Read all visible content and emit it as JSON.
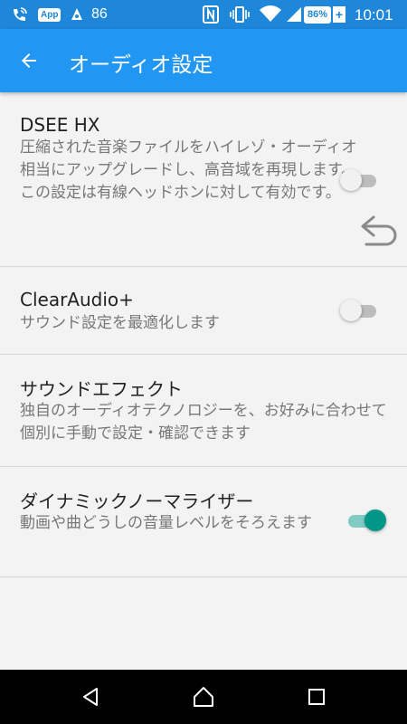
{
  "status_bar": {
    "notification_count": "86",
    "battery_percent": "86%",
    "time": "10:01",
    "icons": [
      "wifi-call-icon",
      "app-icon",
      "notification-icon",
      "nfc-icon",
      "vibrate-icon",
      "wifi-icon",
      "signal-icon",
      "battery-icon",
      "charging-icon"
    ],
    "app_badge": "App"
  },
  "app_bar": {
    "back_icon": "arrow-back-icon",
    "title": "オーディオ設定",
    "color": "#2196f3"
  },
  "settings": {
    "dsee": {
      "title": "DSEE HX",
      "description": "圧縮された音楽ファイルをハイレゾ・オーディオ相当にアップグレードし、高音域を再現します。この設定は有線ヘッドホンに対して有効です。",
      "enabled": false
    },
    "clearaudio": {
      "title": "ClearAudio+",
      "description": "サウンド設定を最適化します",
      "enabled": false
    },
    "sound_effect": {
      "title": "サウンドエフェクト",
      "description": "独自のオーディオテクノロジーを、お好みに合わせて個別に手動で設定・確認できます"
    },
    "normalizer": {
      "title": "ダイナミックノーマライザー",
      "description": "動画や曲どうしの音量レベルをそろえます",
      "enabled": true
    }
  },
  "floating_back_icon": "undo-arrow-icon",
  "nav_bar": {
    "back_icon": "nav-back-icon",
    "home_icon": "nav-home-icon",
    "recents_icon": "nav-recents-icon"
  },
  "colors": {
    "toggle_on": "#009688",
    "toggle_off": "#bdbdbd"
  }
}
